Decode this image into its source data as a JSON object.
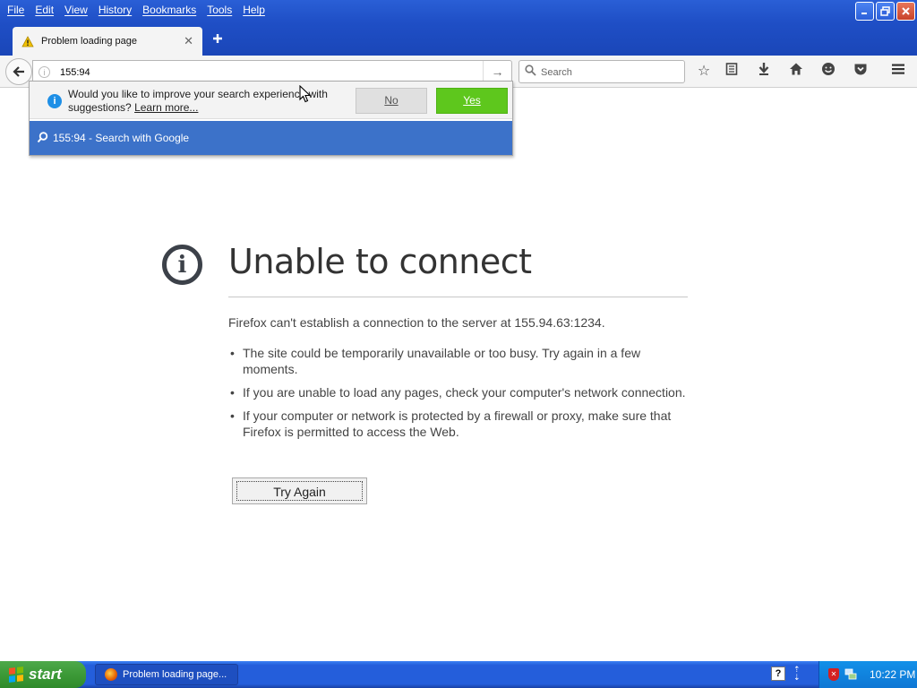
{
  "menu": [
    "File",
    "Edit",
    "View",
    "History",
    "Bookmarks",
    "Tools",
    "Help"
  ],
  "tab": {
    "title": "Problem loading page"
  },
  "urlbar": {
    "value": "155:94"
  },
  "searchbar": {
    "placeholder": "Search"
  },
  "suggest": {
    "prompt": "Would you like to improve your search experience with suggestions?",
    "learn_more": "Learn more...",
    "no": "No",
    "yes": "Yes",
    "row": "155:94 - Search with Google"
  },
  "error": {
    "title": "Unable to connect",
    "description": "Firefox can't establish a connection to the server at 155.94.63:1234.",
    "bullets": [
      "The site could be temporarily unavailable or too busy. Try again in a few moments.",
      "If you are unable to load any pages, check your computer's network connection.",
      "If your computer or network is protected by a firewall or proxy, make sure that Firefox is permitted to access the Web."
    ],
    "try_again": "Try Again"
  },
  "taskbar": {
    "start": "start",
    "task": "Problem loading page...",
    "clock": "10:22 PM"
  },
  "colors": {
    "xp_blue": "#245edb",
    "start_green": "#3c9a37",
    "yes_green": "#5ec71d",
    "suggest_blue": "#3c72c9"
  }
}
